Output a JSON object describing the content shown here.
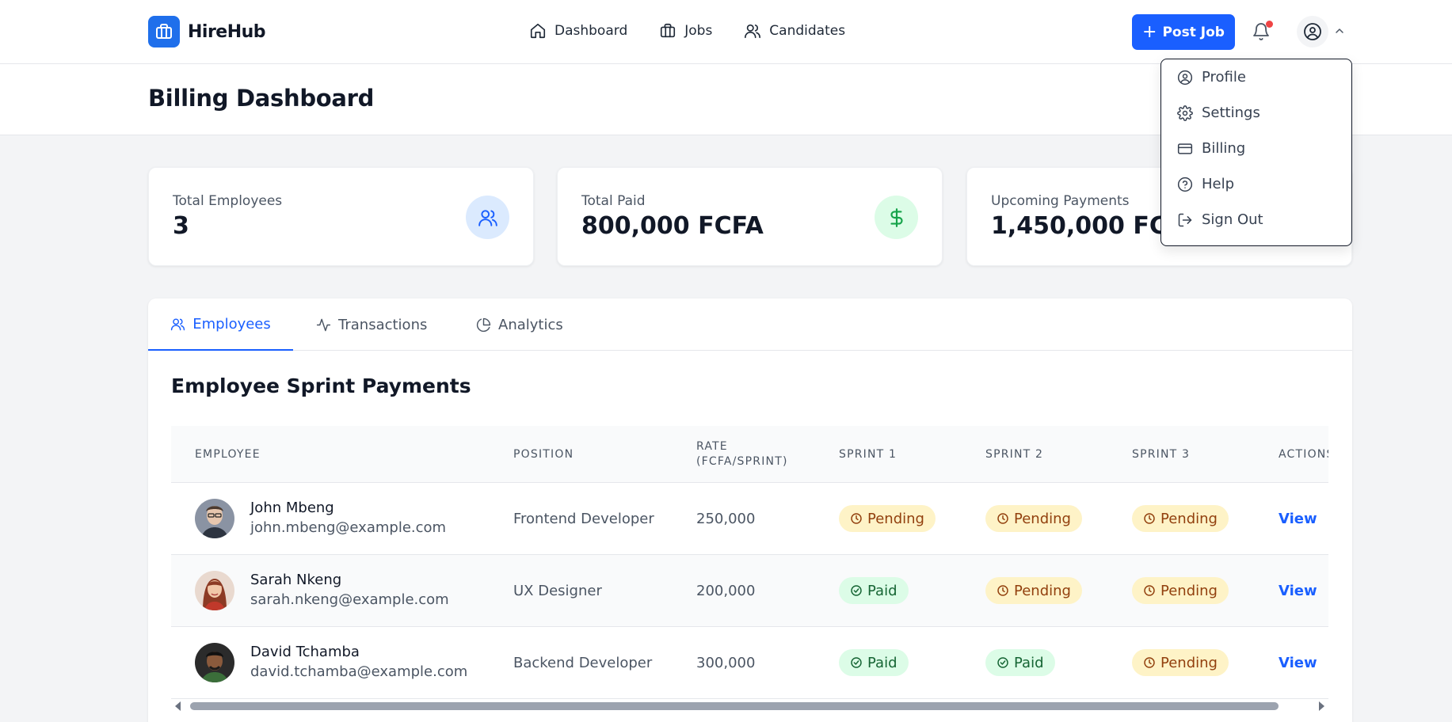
{
  "app": {
    "name": "HireHub",
    "brand_color": "#1a5fff"
  },
  "nav": {
    "links": [
      {
        "label": "Dashboard",
        "icon": "home-icon"
      },
      {
        "label": "Jobs",
        "icon": "briefcase-icon"
      },
      {
        "label": "Candidates",
        "icon": "users-icon"
      }
    ],
    "post_job_label": "Post Job"
  },
  "page": {
    "title": "Billing Dashboard"
  },
  "stats": [
    {
      "label": "Total Employees",
      "value": "3",
      "icon": "users-icon",
      "icon_bg": "#dbeafe",
      "icon_color": "#1a5fff"
    },
    {
      "label": "Total Paid",
      "value": "800,000 FCFA",
      "icon": "dollar-icon",
      "icon_bg": "#dcfce7",
      "icon_color": "#16a34a"
    },
    {
      "label": "Upcoming Payments",
      "value": "1,450,000 FCFA",
      "icon": "clock-icon"
    }
  ],
  "tabs": [
    {
      "label": "Employees",
      "icon": "users-icon",
      "active": true
    },
    {
      "label": "Transactions",
      "icon": "activity-icon",
      "active": false
    },
    {
      "label": "Analytics",
      "icon": "pie-chart-icon",
      "active": false
    }
  ],
  "table": {
    "title": "Employee Sprint Payments",
    "columns": [
      "Employee",
      "Position",
      "Rate (FCFA/Sprint)",
      "Sprint 1",
      "Sprint 2",
      "Sprint 3",
      "Actions"
    ],
    "rows": [
      {
        "name": "John Mbeng",
        "email": "john.mbeng@example.com",
        "position": "Frontend Developer",
        "rate": "250,000",
        "sprints": [
          "Pending",
          "Pending",
          "Pending"
        ],
        "action": "View"
      },
      {
        "name": "Sarah Nkeng",
        "email": "sarah.nkeng@example.com",
        "position": "UX Designer",
        "rate": "200,000",
        "sprints": [
          "Paid",
          "Pending",
          "Pending"
        ],
        "action": "View"
      },
      {
        "name": "David Tchamba",
        "email": "david.tchamba@example.com",
        "position": "Backend Developer",
        "rate": "300,000",
        "sprints": [
          "Paid",
          "Paid",
          "Pending"
        ],
        "action": "View"
      }
    ]
  },
  "user_menu": {
    "items": [
      {
        "label": "Profile",
        "icon": "user-circle-icon"
      },
      {
        "label": "Settings",
        "icon": "gear-icon"
      },
      {
        "label": "Billing",
        "icon": "credit-card-icon"
      },
      {
        "label": "Help",
        "icon": "help-circle-icon"
      },
      {
        "label": "Sign Out",
        "icon": "sign-out-icon"
      }
    ]
  }
}
